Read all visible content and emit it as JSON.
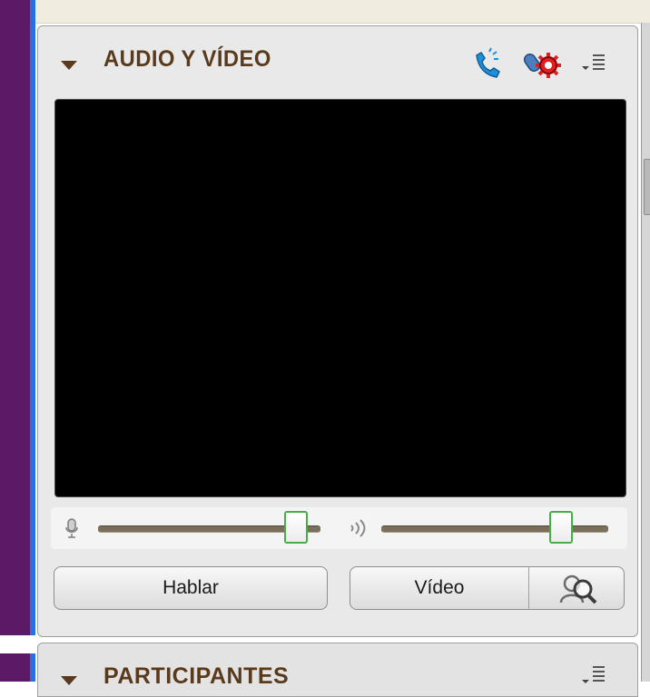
{
  "panel": {
    "title": "AUDIO Y VÍDEO"
  },
  "buttons": {
    "talk": "Hablar",
    "video": "Vídeo"
  },
  "panel2": {
    "title": "PARTICIPANTES"
  },
  "sliders": {
    "microphone_level": 0.78,
    "speaker_level": 0.8
  },
  "colors": {
    "header_text": "#5a3a1c",
    "slider_border": "#45b045",
    "video_bg": "#000000"
  },
  "icons": {
    "collapse": "triangle-down-icon",
    "phone": "phone-icon",
    "mic_settings": "mic-settings-icon",
    "menu": "menu-icon",
    "preview": "preview-icon"
  }
}
